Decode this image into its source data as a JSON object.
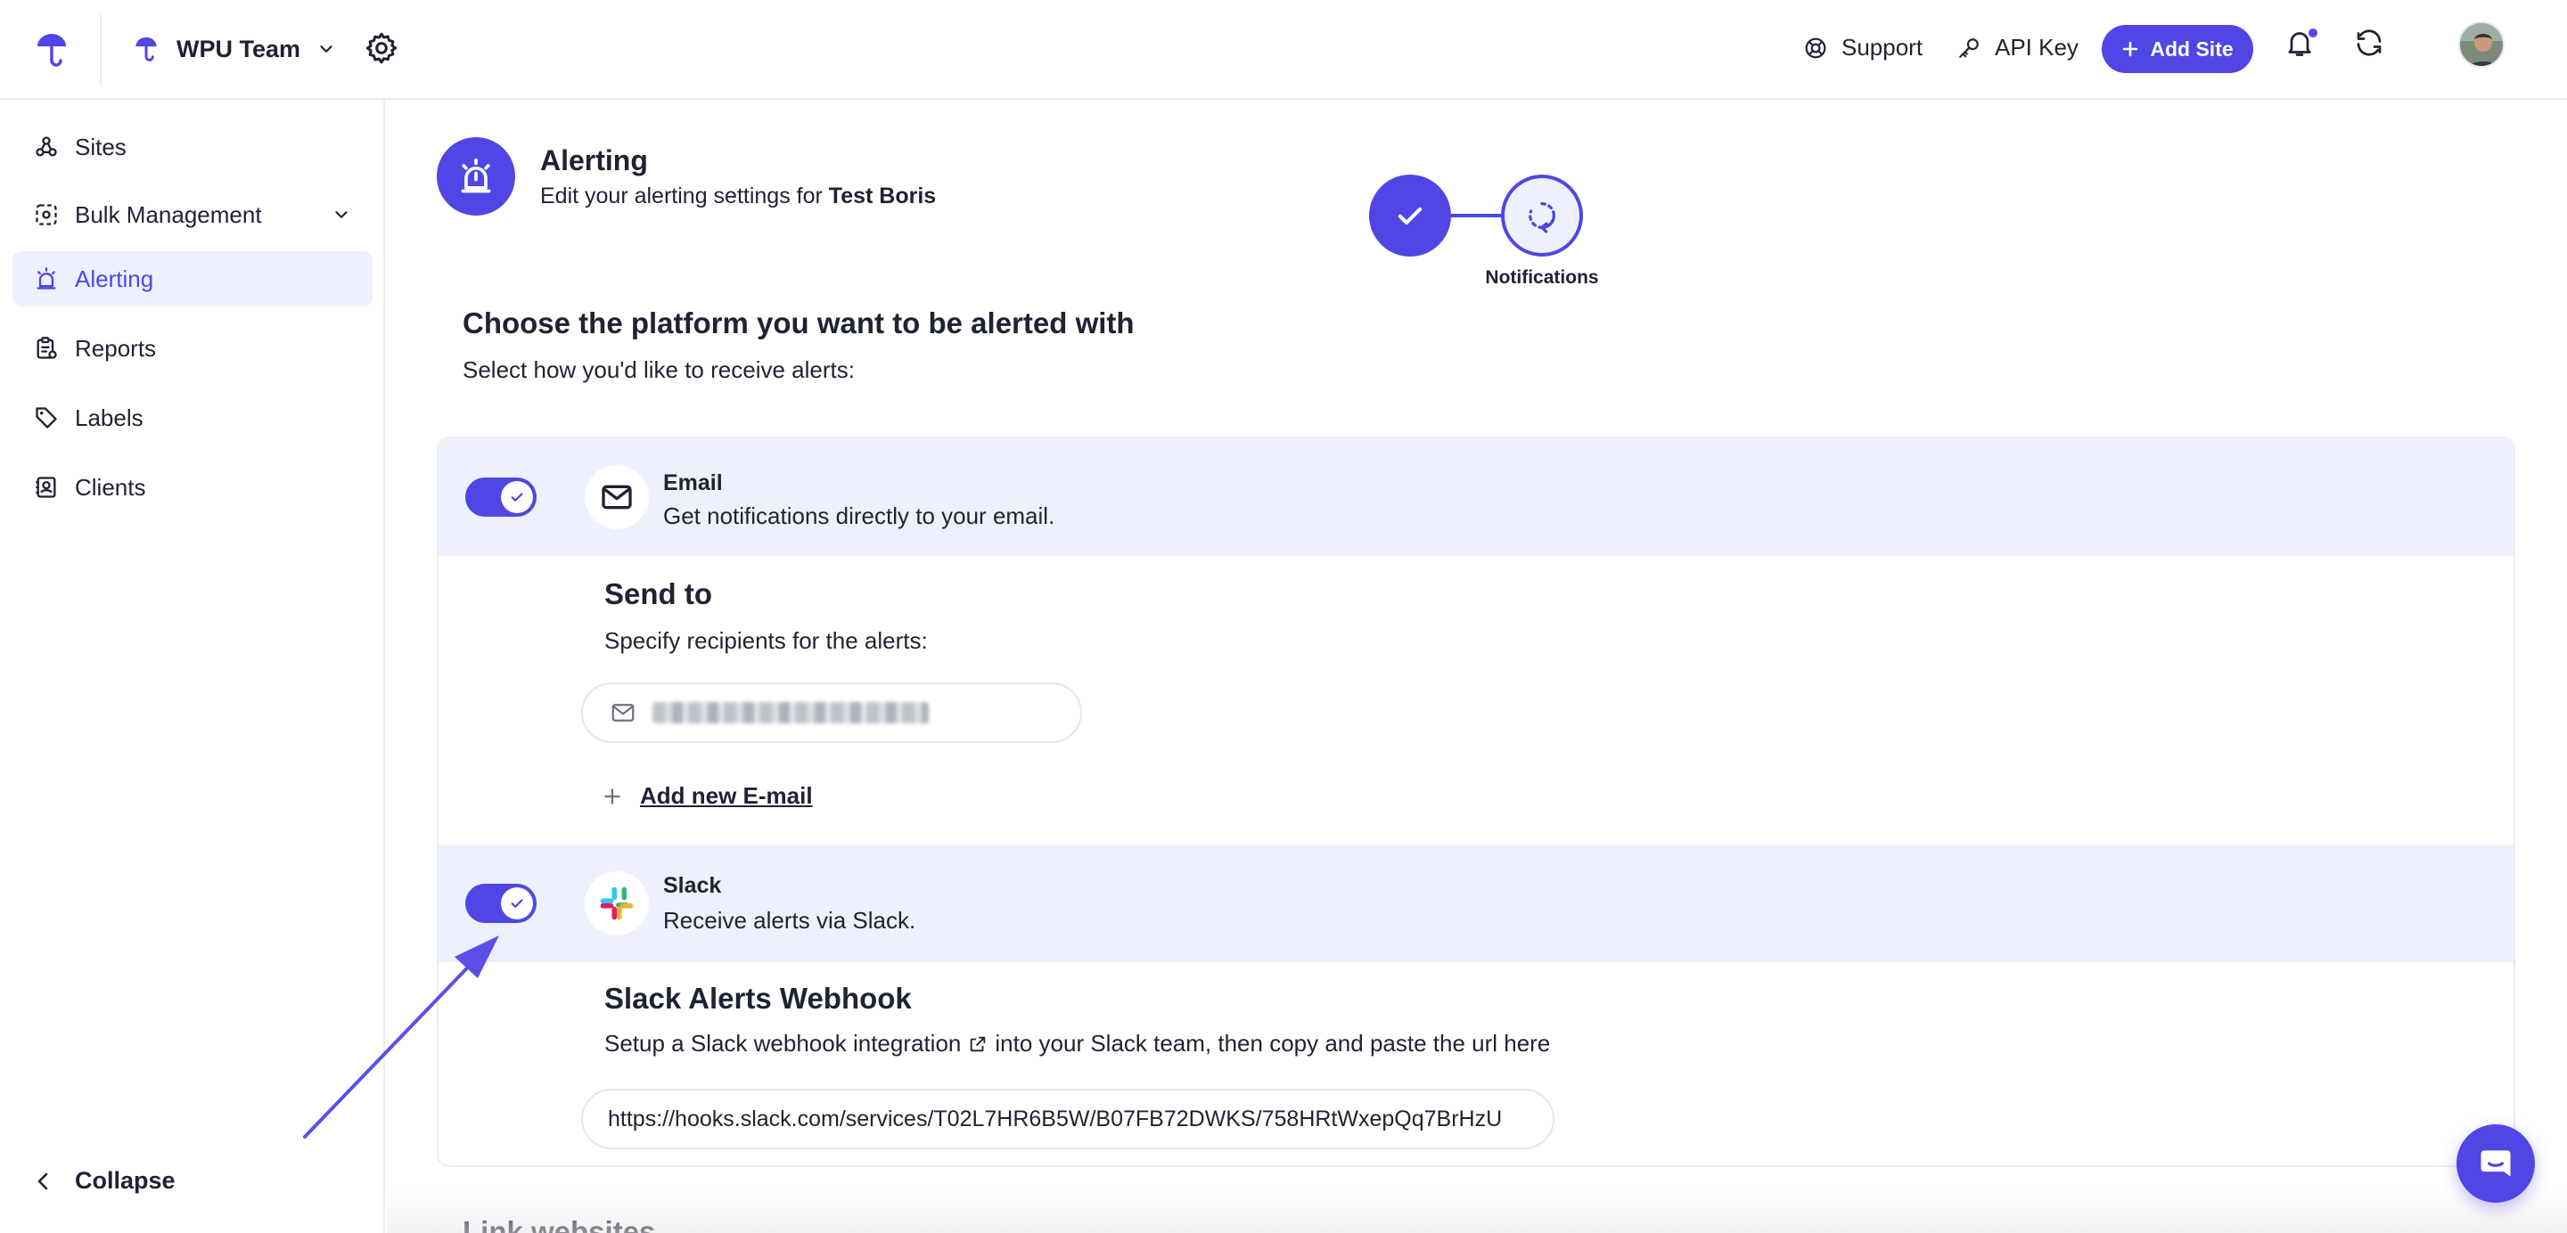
{
  "header": {
    "team_name": "WPU Team",
    "support_label": "Support",
    "api_key_label": "API Key",
    "add_site_label": "Add Site",
    "notification_unread": true
  },
  "sidebar": {
    "items": [
      {
        "label": "Sites",
        "icon": "sites-icon"
      },
      {
        "label": "Bulk Management",
        "icon": "bulk-management-icon",
        "expandable": true
      },
      {
        "label": "Alerting",
        "icon": "alerting-icon",
        "active": true
      },
      {
        "label": "Reports",
        "icon": "reports-icon"
      },
      {
        "label": "Labels",
        "icon": "tag-icon"
      },
      {
        "label": "Clients",
        "icon": "clients-icon"
      }
    ],
    "collapse_label": "Collapse"
  },
  "page": {
    "title": "Alerting",
    "subtitle_prefix": "Edit your alerting settings for",
    "subtitle_site": "Test Boris",
    "stepper": {
      "steps": [
        {
          "status": "done"
        },
        {
          "label": "Notifications",
          "status": "current"
        }
      ]
    },
    "section_title": "Choose the platform you want to be alerted with",
    "section_subtitle": "Select how you'd like to receive alerts:"
  },
  "channels": {
    "email": {
      "title": "Email",
      "description": "Get notifications directly to your email.",
      "enabled": true,
      "send_to_title": "Send to",
      "send_to_desc": "Specify recipients for the alerts:",
      "add_email_label": "Add new E-mail"
    },
    "slack": {
      "title": "Slack",
      "description": "Receive alerts via Slack.",
      "enabled": true,
      "webhook_title": "Slack Alerts Webhook",
      "webhook_desc_before": "Setup a Slack webhook integration",
      "webhook_desc_after": "into your Slack team, then copy and paste the url here",
      "webhook_url": "https://hooks.slack.com/services/T02L7HR6B5W/B07FB72DWKS/758HRtWxepQq7BrHzU"
    }
  },
  "next_section_title": "Link websites",
  "colors": {
    "accent": "#4f46e5",
    "accent_light": "#eef0fd",
    "text": "#1f2233",
    "border": "#eceef3"
  }
}
